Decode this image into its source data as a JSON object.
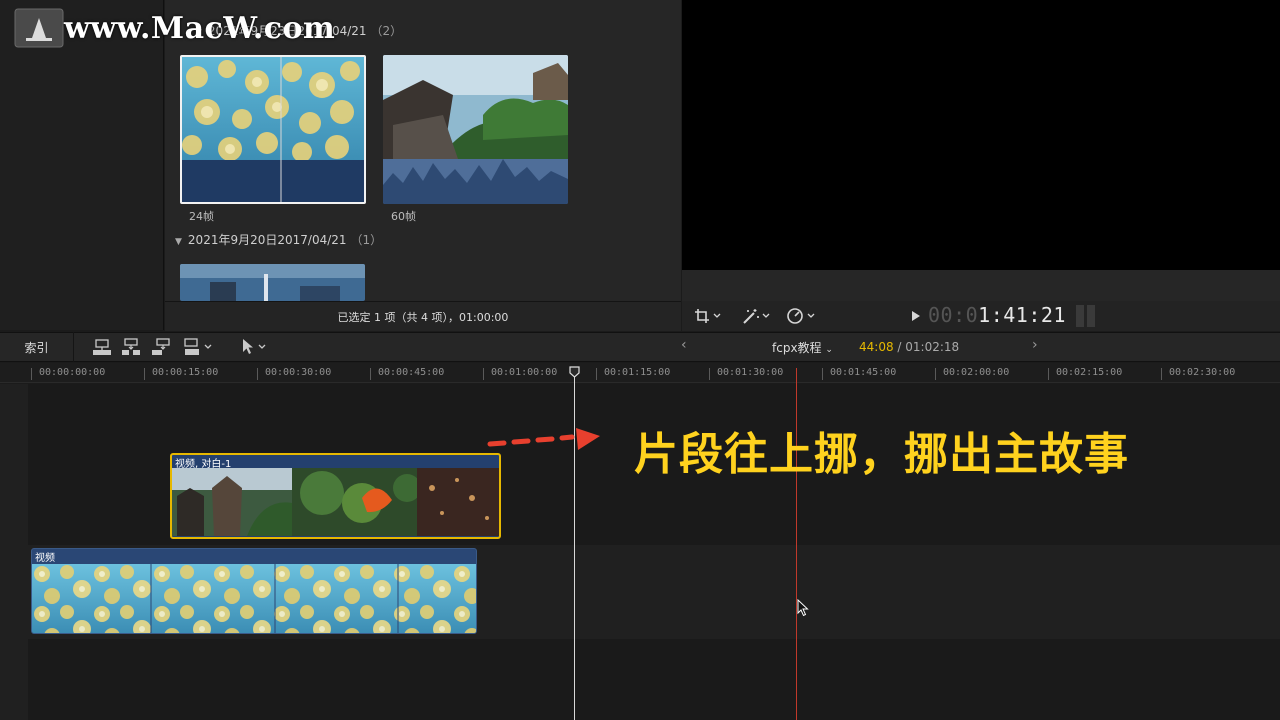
{
  "watermark": {
    "text": "www.MacW.com"
  },
  "browser": {
    "groups": [
      {
        "title": "2021年9月23日2017/04/21",
        "count": "（2）"
      },
      {
        "title": "2021年9月20日2017/04/21",
        "count": "（1）"
      }
    ],
    "clips": [
      {
        "fps": "24帧"
      },
      {
        "fps": "60帧"
      }
    ],
    "footer": "已选定 1 项（共 4 项），01:00:00"
  },
  "viewer": {
    "timecode_dim": "00:0",
    "timecode": "1:41:21"
  },
  "timeline_toolbar": {
    "index_label": "索引",
    "project_name": "fcpx教程",
    "duration_current": "44:08",
    "duration_total": " / 01:02:18"
  },
  "ruler": {
    "ticks": [
      "00:00:00:00",
      "00:00:15:00",
      "00:00:30:00",
      "00:00:45:00",
      "00:01:00:00",
      "00:01:15:00",
      "00:01:30:00",
      "00:01:45:00",
      "00:02:00:00",
      "00:02:15:00",
      "00:02:30:00"
    ]
  },
  "timeline": {
    "connected_clip": {
      "label": "视频, 对白-1"
    },
    "primary_clip": {
      "label": "视频"
    },
    "annotation": "片段往上挪，挪出主故事"
  },
  "colors": {
    "accent": "#e6b800",
    "skimmer": "#c0392b",
    "annotation": "#ffd21e",
    "arrow": "#e8402e"
  },
  "icons": [
    "crop-icon",
    "magic-wand-icon",
    "speed-icon",
    "play-icon",
    "append-icon",
    "insert-icon",
    "connect-icon",
    "overwrite-icon",
    "select-tool-icon",
    "chevron-left-icon",
    "chevron-right-icon"
  ]
}
